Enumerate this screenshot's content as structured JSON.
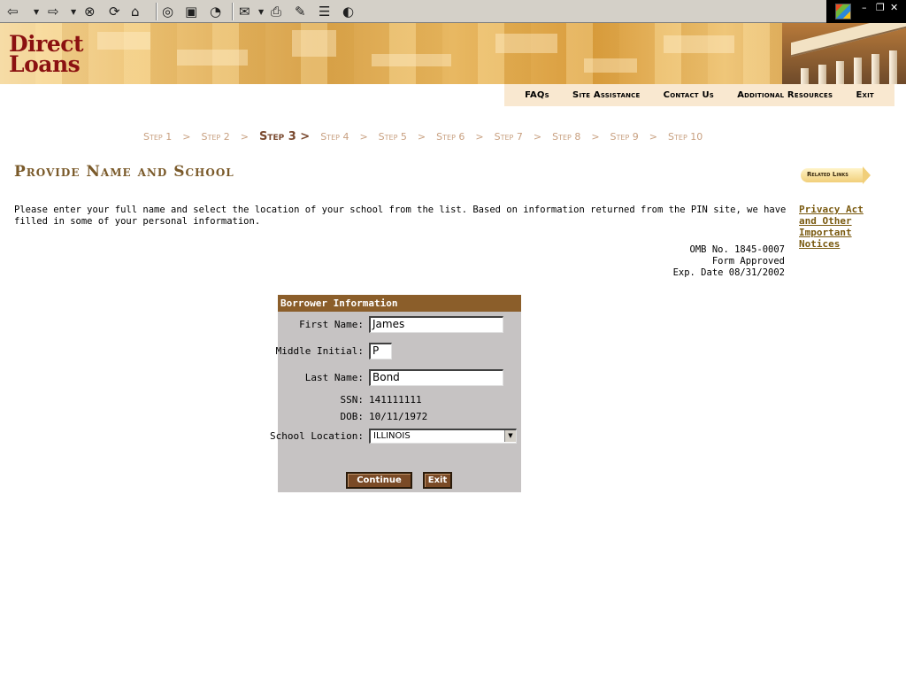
{
  "browser": {
    "toolbar_icons": [
      "back-arrow-icon",
      "back-dropdown-icon",
      "forward-arrow-icon",
      "forward-dropdown-icon",
      "stop-icon",
      "refresh-icon",
      "home-icon",
      "search-icon",
      "favorites-icon",
      "history-icon",
      "mail-icon",
      "print-icon",
      "edit-icon",
      "discuss-icon",
      "messenger-icon"
    ]
  },
  "site": {
    "logo_line1": "Direct",
    "logo_line2": "Loans"
  },
  "nav": {
    "items": [
      "FAQs",
      "Site Assistance",
      "Contact Us",
      "Additional Resources",
      "Exit"
    ]
  },
  "steps": {
    "items": [
      "Step 1",
      "Step 2",
      "Step 3",
      "Step 4",
      "Step 5",
      "Step 6",
      "Step 7",
      "Step 8",
      "Step 9",
      "Step 10"
    ],
    "separator": ">",
    "current_index": 2
  },
  "page": {
    "title": "Provide Name and School",
    "intro": "Please enter your full name and select the location of your school from the list. Based on information returned from the PIN site, we have filled in some of your personal information.",
    "omb_number": "OMB No. 1845-0007",
    "form_approved": "Form Approved",
    "exp_date": "Exp. Date 08/31/2002"
  },
  "related": {
    "badge": "Related Links",
    "link": "Privacy Act and Other Important Notices"
  },
  "form": {
    "header": "Borrower Information",
    "first_name_label": "First Name:",
    "first_name_value": "James",
    "middle_initial_label": "Middle Initial:",
    "middle_initial_value": "P",
    "last_name_label": "Last Name:",
    "last_name_value": "Bond",
    "ssn_label": "SSN:",
    "ssn_value": "141111111",
    "dob_label": "DOB:",
    "dob_value": "10/11/1972",
    "school_label": "School Location:",
    "school_value": "ILLINOIS",
    "continue_label": "Continue",
    "exit_label": "Exit"
  },
  "colors": {
    "accent_brown": "#8b5e2a",
    "title_brown": "#7a5a2a",
    "logo_red": "#8b1111",
    "form_bg": "#c6c3c3",
    "nav_bg": "#f9e8d0"
  }
}
